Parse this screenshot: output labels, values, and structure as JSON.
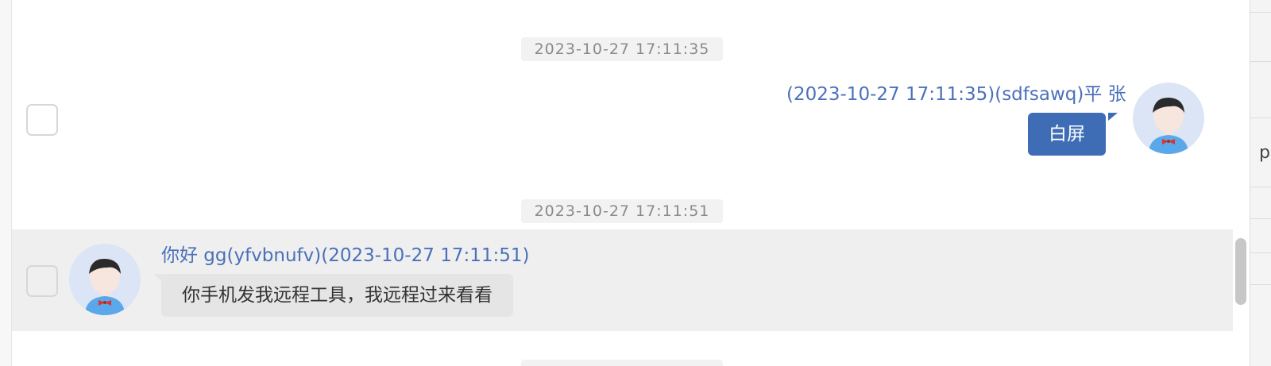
{
  "chat": {
    "messages": [
      {
        "timestamp": "2023-10-27 17:11:35",
        "direction": "outgoing",
        "header": "(2023-10-27 17:11:35)(sdfsawq)平 张",
        "text": "白屏",
        "avatar_icon": "user-avatar-icon"
      },
      {
        "timestamp": "2023-10-27 17:11:51",
        "direction": "incoming",
        "header": "你好 gg(yfvbnufv)(2023-10-27 17:11:51)",
        "text": "你手机发我远程工具，我远程过来看看",
        "avatar_icon": "user-avatar-icon"
      }
    ]
  },
  "side_panel": {
    "partial_char": "p"
  },
  "colors": {
    "outgoing_bubble": "#3f6db5",
    "incoming_bubble": "#e5e5e5",
    "header_text": "#4a70ba",
    "selected_row": "#efefef",
    "timestamp_chip": "#f2f2f2"
  }
}
